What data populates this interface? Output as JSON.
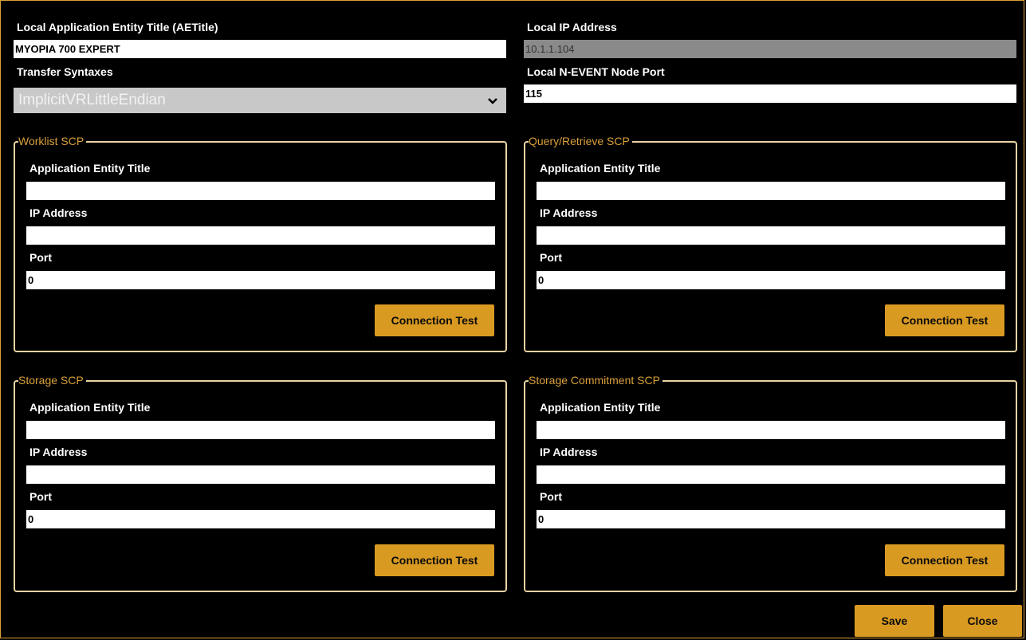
{
  "local": {
    "ae_title_label": "Local Application Entity Title (AETitle)",
    "ae_title_value": "MYOPIA 700 EXPERT",
    "ip_label": "Local IP Address",
    "ip_value": "10.1.1.104",
    "transfer_syntaxes_label": "Transfer Syntaxes",
    "transfer_syntax_selected": "ImplicitVRLittleEndian",
    "nevent_port_label": "Local N-EVENT Node Port",
    "nevent_port_value": "115"
  },
  "groups": {
    "worklist": {
      "title": "Worklist SCP",
      "ae_label": "Application Entity Title",
      "ae_value": "",
      "ip_label": "IP Address",
      "ip_value": "",
      "port_label": "Port",
      "port_value": "0",
      "test_button": "Connection Test"
    },
    "query": {
      "title": "Query/Retrieve SCP",
      "ae_label": "Application Entity Title",
      "ae_value": "",
      "ip_label": "IP Address",
      "ip_value": "",
      "port_label": "Port",
      "port_value": "0",
      "test_button": "Connection Test"
    },
    "storage": {
      "title": "Storage SCP",
      "ae_label": "Application Entity Title",
      "ae_value": "",
      "ip_label": "IP Address",
      "ip_value": "",
      "port_label": "Port",
      "port_value": "0",
      "test_button": "Connection Test"
    },
    "commitment": {
      "title": "Storage Commitment SCP",
      "ae_label": "Application Entity Title",
      "ae_value": "",
      "ip_label": "IP Address",
      "ip_value": "",
      "port_label": "Port",
      "port_value": "0",
      "test_button": "Connection Test"
    }
  },
  "footer": {
    "save_label": "Save",
    "close_label": "Close"
  },
  "colors": {
    "accent": "#d99a22",
    "group_border": "#e9d3a3",
    "background": "#000000"
  }
}
